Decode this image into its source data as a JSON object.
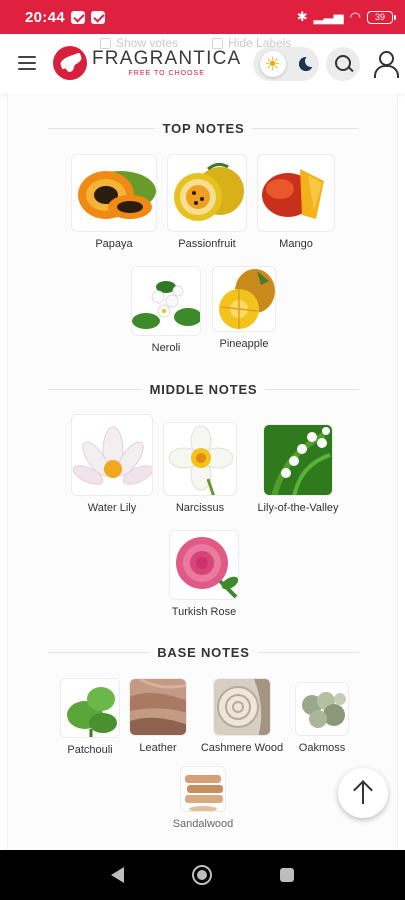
{
  "status_bar": {
    "time": "20:44",
    "battery": "39"
  },
  "header": {
    "ghost_show_votes": "Show votes",
    "ghost_hide_labels": "Hide Labels",
    "logo_name": "FRAGRANTICA",
    "logo_tagline": "FREE TO CHOOSE"
  },
  "sections": {
    "top": {
      "title": "TOP NOTES",
      "notes": [
        "Papaya",
        "Passionfruit",
        "Mango",
        "Neroli",
        "Pineapple"
      ]
    },
    "middle": {
      "title": "MIDDLE NOTES",
      "notes": [
        "Water Lily",
        "Narcissus",
        "Lily-of-the-Valley",
        "Turkish Rose"
      ]
    },
    "base": {
      "title": "BASE NOTES",
      "notes": [
        "Patchouli",
        "Leather",
        "Cashmere Wood",
        "Oakmoss",
        "Sandalwood"
      ]
    }
  },
  "colors": {
    "brand_red": "#e0203f",
    "nav_black": "#000000"
  },
  "icons": {
    "menu": "hamburger-icon",
    "theme_light": "sun-icon",
    "theme_dark": "moon-icon",
    "search": "search-icon",
    "profile": "user-icon",
    "scroll_top": "arrow-up-icon"
  }
}
